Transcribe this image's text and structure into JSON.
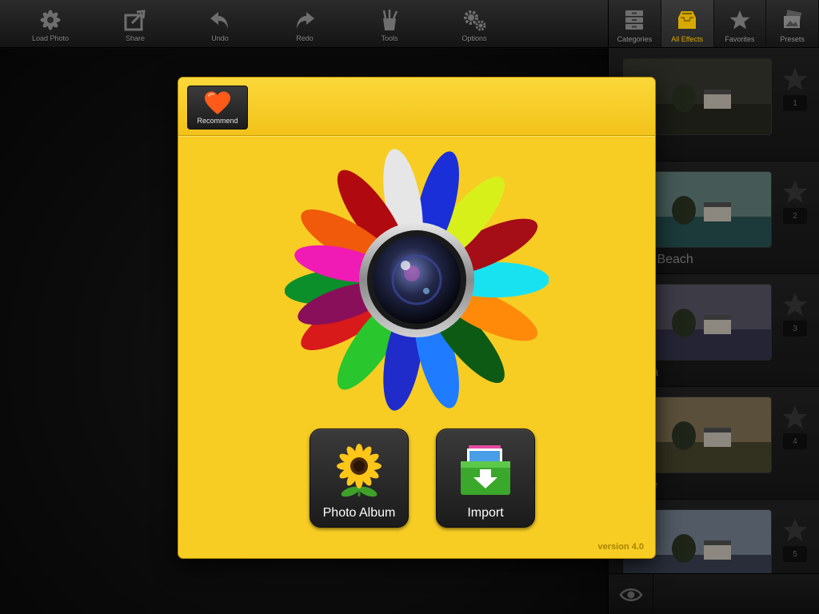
{
  "toolbar": {
    "items": [
      {
        "label": "Load Photo",
        "icon": "flower-icon"
      },
      {
        "label": "Share",
        "icon": "share-icon"
      },
      {
        "label": "Undo",
        "icon": "undo-icon"
      },
      {
        "label": "Redo",
        "icon": "redo-icon"
      },
      {
        "label": "Tools",
        "icon": "tools-icon"
      },
      {
        "label": "Options",
        "icon": "gears-icon"
      }
    ]
  },
  "panel": {
    "tabs": [
      {
        "label": "Categories",
        "icon": "drawers-icon",
        "active": false
      },
      {
        "label": "All Effects",
        "icon": "inbox-icon",
        "active": true
      },
      {
        "label": "Favorites",
        "icon": "star-icon",
        "active": false
      },
      {
        "label": "Presets",
        "icon": "photos-icon",
        "active": false
      }
    ],
    "effects": [
      {
        "number": "1",
        "name": "",
        "sky": "#3c3c34",
        "ground": "#2a2b22"
      },
      {
        "number": "2",
        "name": "tic Beach",
        "sky": "#6b8a86",
        "ground": "#2a5a58"
      },
      {
        "number": "3",
        "name": "ma",
        "sky": "#5e5b6a",
        "ground": "#3a3852"
      },
      {
        "number": "4",
        "name": "ale",
        "sky": "#8b7a5a",
        "ground": "#4e4a30"
      },
      {
        "number": "5",
        "name": "",
        "sky": "#7d8a9c",
        "ground": "#3e4658"
      }
    ]
  },
  "modal": {
    "recommend_label": "Recommend",
    "photo_album_label": "Photo Album",
    "import_label": "Import",
    "version": "version 4.0",
    "background_color": "#f7cd24"
  }
}
